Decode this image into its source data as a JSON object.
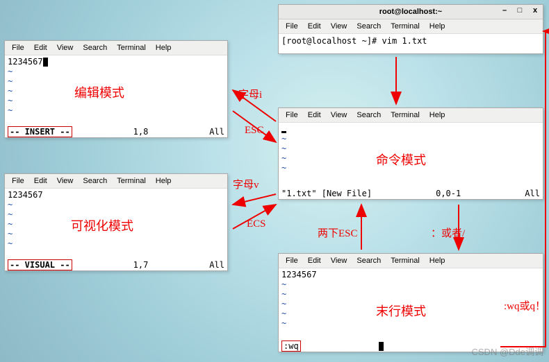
{
  "menus": {
    "file": "File",
    "edit": "Edit",
    "view": "View",
    "search": "Search",
    "terminal": "Terminal",
    "help": "Help"
  },
  "title_window": {
    "title": "root@localhost:~",
    "min": "–",
    "max": "□",
    "close": "x",
    "prompt": "[root@localhost ~]# vim 1.txt"
  },
  "insert": {
    "content": "1234567",
    "mode_status": "-- INSERT --",
    "pos": "1,8",
    "pct": "All",
    "mode_label": "编辑模式"
  },
  "command": {
    "file_status": "\"1.txt\" [New File]",
    "pos": "0,0-1",
    "pct": "All",
    "mode_label": "命令模式"
  },
  "visual": {
    "content": "1234567",
    "mode_status": "-- VISUAL --",
    "pos": "1,7",
    "pct": "All",
    "mode_label": "可视化模式"
  },
  "exline": {
    "content": "1234567",
    "cmd": ":wq",
    "mode_label": "末行模式"
  },
  "anno": {
    "letter_i": "字母i",
    "esc1": "ESC",
    "letter_v": "字母v",
    "ecs": "ECS",
    "two_esc": "两下ESC",
    "colon_or": "：或者/",
    "wq_or_q": ":wq或q！"
  },
  "watermark": "CSDN @Dde调调"
}
